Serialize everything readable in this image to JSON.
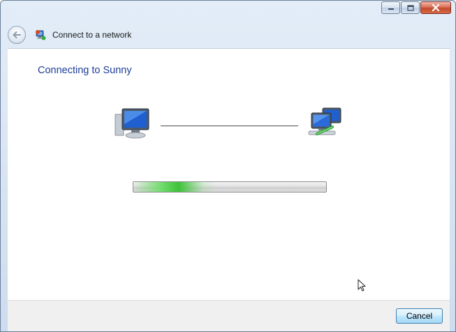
{
  "window": {
    "title": "Connect to a network",
    "caption_buttons": [
      "minimize-icon",
      "maximize-icon",
      "close-icon"
    ]
  },
  "header": {
    "back_icon": "back-arrow-icon",
    "title_icon": "network-globe-icon"
  },
  "main": {
    "heading": "Connecting to Sunny",
    "source_icon": "computer-icon",
    "target_icon": "network-computers-icon",
    "progress_state": "indeterminate"
  },
  "footer": {
    "cancel_label": "Cancel"
  },
  "colors": {
    "heading": "#1e3e99",
    "progress_green": "#3ec23a",
    "accent_button_border": "#3c7fb1"
  }
}
